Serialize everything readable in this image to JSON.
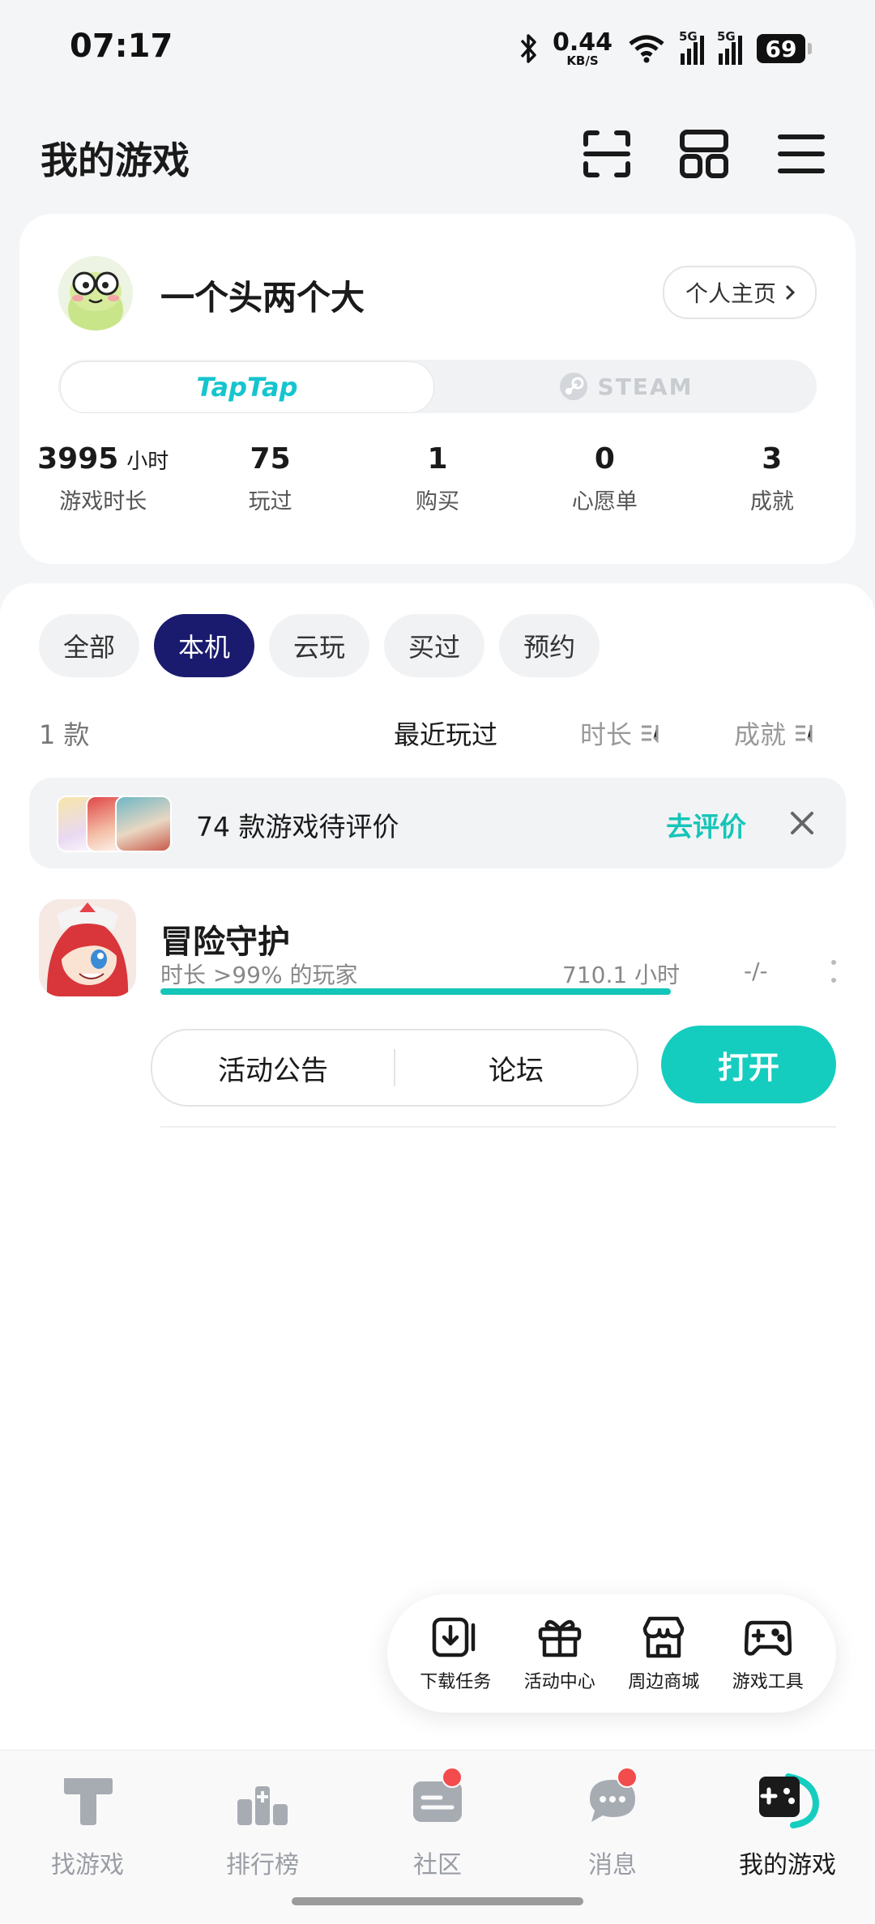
{
  "status_bar": {
    "time": "07:17",
    "net_speed_value": "0.44",
    "net_speed_unit": "KB/S",
    "network_1": "5G",
    "network_2": "5G",
    "battery": "69",
    "icons": [
      "bluetooth-icon",
      "wifi-icon",
      "signal-icon",
      "signal-icon",
      "battery-icon"
    ]
  },
  "header": {
    "title": "我的游戏",
    "icons": [
      "scan-icon",
      "grid-layout-icon",
      "menu-icon"
    ]
  },
  "profile": {
    "username": "一个头两个大",
    "profile_link": "个人主页",
    "platforms": {
      "taptap": "TapTap",
      "steam": "STEAM",
      "selected": "taptap"
    },
    "stats": [
      {
        "value": "3995",
        "unit": "小时",
        "label": "游戏时长"
      },
      {
        "value": "75",
        "label": "玩过"
      },
      {
        "value": "1",
        "label": "购买"
      },
      {
        "value": "0",
        "label": "心愿单"
      },
      {
        "value": "3",
        "label": "成就"
      }
    ]
  },
  "filters": {
    "chips": [
      "全部",
      "本机",
      "云玩",
      "买过",
      "预约"
    ],
    "active": "本机"
  },
  "sort": {
    "count": "1 款",
    "options": [
      "最近玩过",
      "时长",
      "成就"
    ],
    "active": "最近玩过"
  },
  "review_banner": {
    "text": "74 款游戏待评价",
    "action": "去评价"
  },
  "games": [
    {
      "name": "冒险守护",
      "playtime_rank": "时长 >99% 的玩家",
      "hours": "710.1 小时",
      "achievements": "-/-",
      "progress": 1.0,
      "actions": [
        "活动公告",
        "论坛"
      ],
      "open_label": "打开"
    }
  ],
  "toolbar": {
    "items": [
      {
        "label": "下载任务",
        "icon": "download-icon"
      },
      {
        "label": "活动中心",
        "icon": "gift-icon"
      },
      {
        "label": "周边商城",
        "icon": "shop-icon"
      },
      {
        "label": "游戏工具",
        "icon": "gamepad-icon"
      }
    ]
  },
  "bottom_nav": {
    "items": [
      {
        "label": "找游戏",
        "icon": "find-games-icon",
        "badge": false
      },
      {
        "label": "排行榜",
        "icon": "ranking-icon",
        "badge": false
      },
      {
        "label": "社区",
        "icon": "community-icon",
        "badge": true
      },
      {
        "label": "消息",
        "icon": "message-icon",
        "badge": true
      },
      {
        "label": "我的游戏",
        "icon": "my-games-icon",
        "badge": false
      }
    ],
    "active": "我的游戏"
  },
  "colors": {
    "accent": "#15CDBF",
    "active_chip": "#1A1A6E",
    "badge": "#F24C4C"
  }
}
